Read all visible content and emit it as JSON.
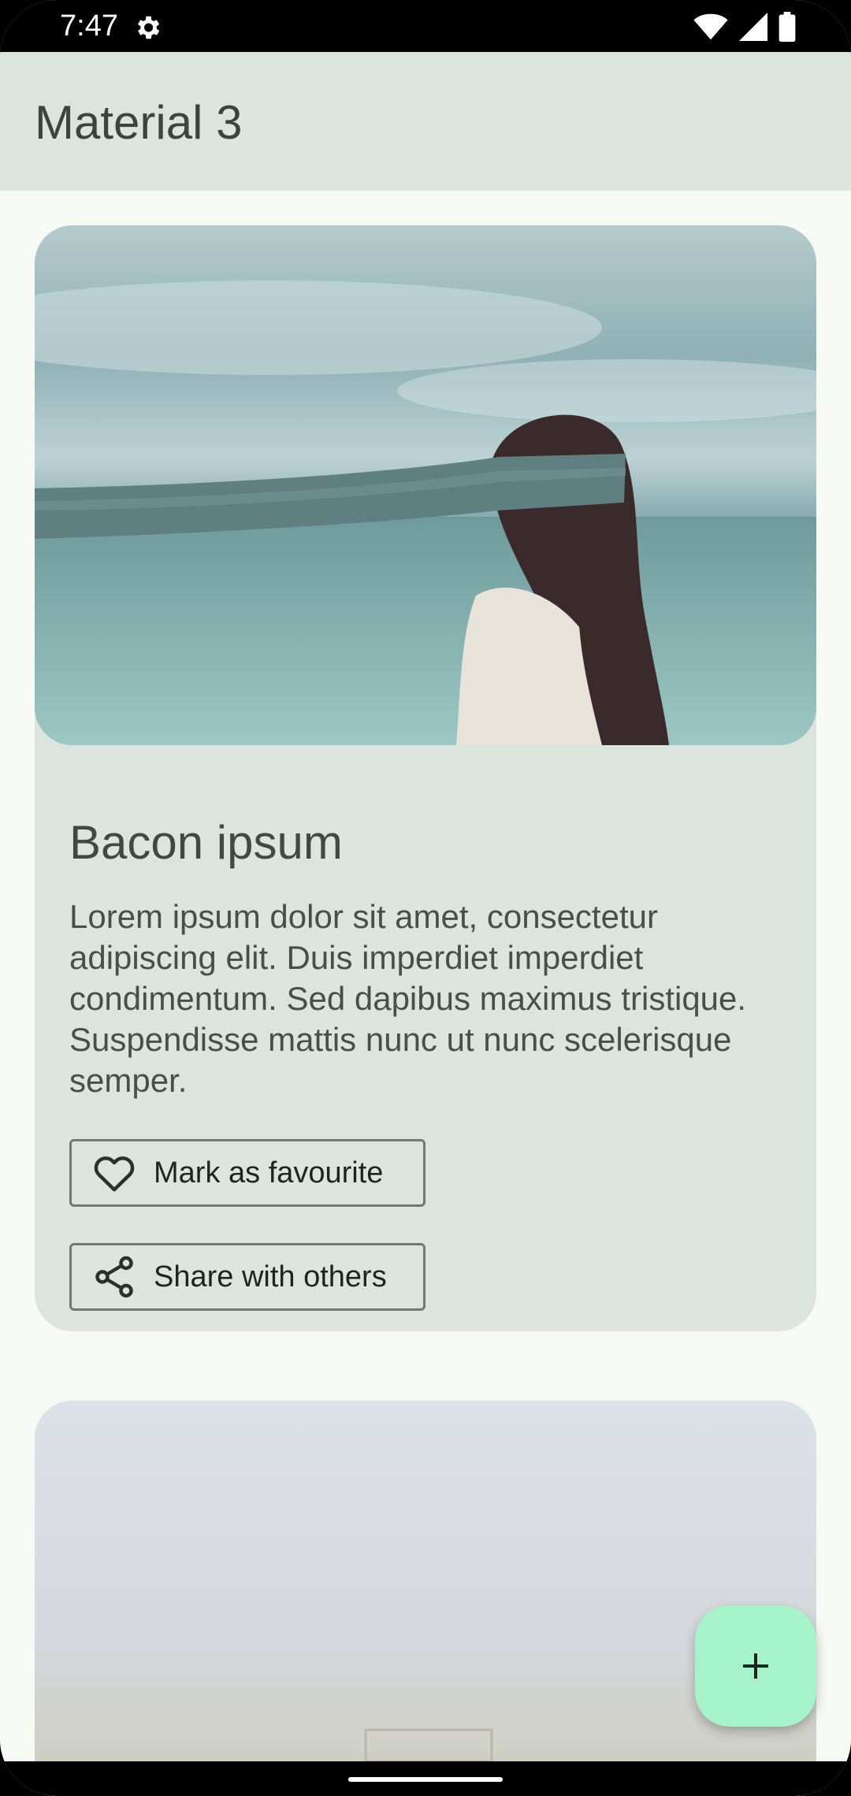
{
  "status_bar": {
    "time": "7:47",
    "icons": [
      "settings-gear-icon",
      "wifi-icon",
      "signal-icon",
      "battery-icon"
    ]
  },
  "app_bar": {
    "title": "Material 3",
    "background": "#dce5dd"
  },
  "cards": [
    {
      "image": "woman-blindfold-sea-photo",
      "title": "Bacon ipsum",
      "body": "Lorem ipsum dolor sit amet, consectetur adipiscing elit. Duis imperdiet imperdiet condimentum. Sed dapibus maximus tristique. Suspendisse mattis nunc ut nunc scelerisque semper.",
      "actions": [
        {
          "label": "Mark as favourite",
          "icon": "heart-outline-icon"
        },
        {
          "label": "Share with others",
          "icon": "share-icon"
        }
      ]
    },
    {
      "image": "misty-landscape-photo"
    }
  ],
  "fab": {
    "icon": "plus-icon",
    "color": "#a6f2c9"
  },
  "colors": {
    "surface": "#f6f9f4",
    "card": "#dce5dd",
    "outline": "#6f7a73"
  }
}
